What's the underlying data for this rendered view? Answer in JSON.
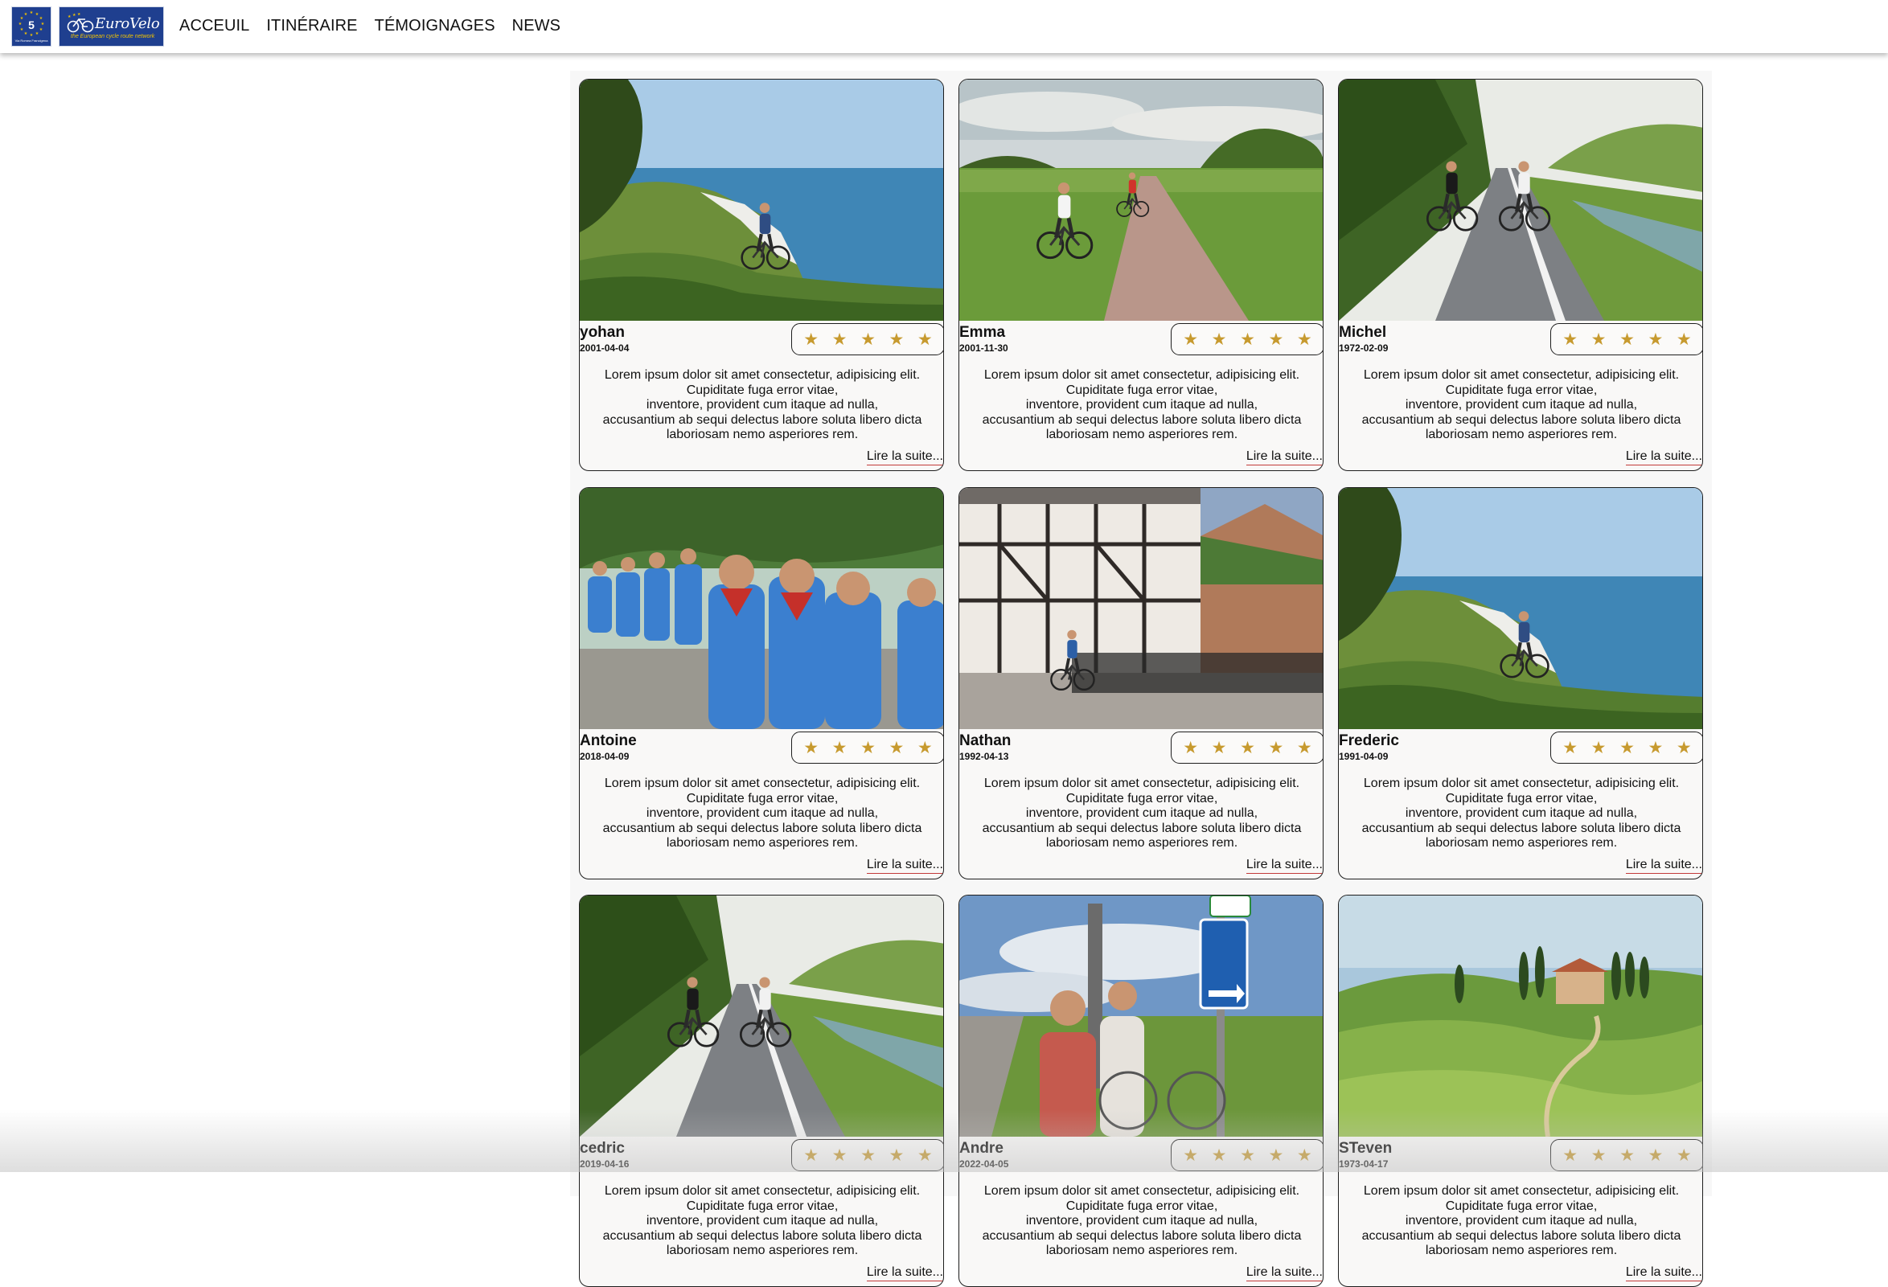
{
  "header": {
    "logo_ev5_number": "5",
    "logo_ev5_subtitle": "Via Romea Francigena",
    "logo_brand": "EuroVelo",
    "logo_tagline": "the European cycle route network",
    "nav": [
      {
        "label": "ACCEUIL"
      },
      {
        "label": "ITINÉRAIRE"
      },
      {
        "label": "TÉMOIGNAGES"
      },
      {
        "label": "NEWS"
      }
    ]
  },
  "colors": {
    "logo_blue": "#1f3f8f",
    "star_gold": "#c79a2f",
    "link_underline": "#c23a3a"
  },
  "testimonials": [
    {
      "name": "yohan",
      "date": "2001-04-04",
      "rating": 5,
      "photo": "cliff-coast-cyclist",
      "text": "Lorem ipsum dolor sit amet consectetur, adipisicing elit.\nCupiditate fuga error vitae,\ninventore, provident cum itaque ad nulla,\naccusantium ab sequi delectus labore soluta libero dicta\nlaboriosam nemo asperiores rem.",
      "more": "Lire la suite..."
    },
    {
      "name": "Emma",
      "date": "2001-11-30",
      "rating": 5,
      "photo": "country-road-cyclists",
      "text": "Lorem ipsum dolor sit amet consectetur, adipisicing elit.\nCupiditate fuga error vitae,\ninventore, provident cum itaque ad nulla,\naccusantium ab sequi delectus labore soluta libero dicta\nlaboriosam nemo asperiores rem.",
      "more": "Lire la suite..."
    },
    {
      "name": "Michel",
      "date": "1972-02-09",
      "rating": 5,
      "photo": "canal-path-couple",
      "text": "Lorem ipsum dolor sit amet consectetur, adipisicing elit.\nCupiditate fuga error vitae,\ninventore, provident cum itaque ad nulla,\naccusantium ab sequi delectus labore soluta libero dicta\nlaboriosam nemo asperiores rem.",
      "more": "Lire la suite..."
    },
    {
      "name": "Antoine",
      "date": "2018-04-09",
      "rating": 5,
      "photo": "group-scouts",
      "text": "Lorem ipsum dolor sit amet consectetur, adipisicing elit.\nCupiditate fuga error vitae,\ninventore, provident cum itaque ad nulla,\naccusantium ab sequi delectus labore soluta libero dicta\nlaboriosam nemo asperiores rem.",
      "more": "Lire la suite..."
    },
    {
      "name": "Nathan",
      "date": "1992-04-13",
      "rating": 5,
      "photo": "timber-houses-cyclist",
      "text": "Lorem ipsum dolor sit amet consectetur, adipisicing elit.\nCupiditate fuga error vitae,\ninventore, provident cum itaque ad nulla,\naccusantium ab sequi delectus labore soluta libero dicta\nlaboriosam nemo asperiores rem.",
      "more": "Lire la suite..."
    },
    {
      "name": "Frederic",
      "date": "1991-04-09",
      "rating": 5,
      "photo": "cliff-coast-cyclist",
      "text": "Lorem ipsum dolor sit amet consectetur, adipisicing elit.\nCupiditate fuga error vitae,\ninventore, provident cum itaque ad nulla,\naccusantium ab sequi delectus labore soluta libero dicta\nlaboriosam nemo asperiores rem.",
      "more": "Lire la suite..."
    },
    {
      "name": "cedric",
      "date": "2019-04-16",
      "rating": 5,
      "photo": "canal-path-couple",
      "text": "Lorem ipsum dolor sit amet consectetur, adipisicing elit.\nCupiditate fuga error vitae,\ninventore, provident cum itaque ad nulla,\naccusantium ab sequi delectus labore soluta libero dicta\nlaboriosam nemo asperiores rem.",
      "more": "Lire la suite..."
    },
    {
      "name": "Andre",
      "date": "2022-04-05",
      "rating": 5,
      "photo": "signpost-couple",
      "text": "Lorem ipsum dolor sit amet consectetur, adipisicing elit.\nCupiditate fuga error vitae,\ninventore, provident cum itaque ad nulla,\naccusantium ab sequi delectus labore soluta libero dicta\nlaboriosam nemo asperiores rem.",
      "more": "Lire la suite..."
    },
    {
      "name": "STeven",
      "date": "1973-04-17",
      "rating": 5,
      "photo": "tuscany-hills",
      "text": "Lorem ipsum dolor sit amet consectetur, adipisicing elit.\nCupiditate fuga error vitae,\ninventore, provident cum itaque ad nulla,\naccusantium ab sequi delectus labore soluta libero dicta\nlaboriosam nemo asperiores rem.",
      "more": "Lire la suite..."
    }
  ]
}
